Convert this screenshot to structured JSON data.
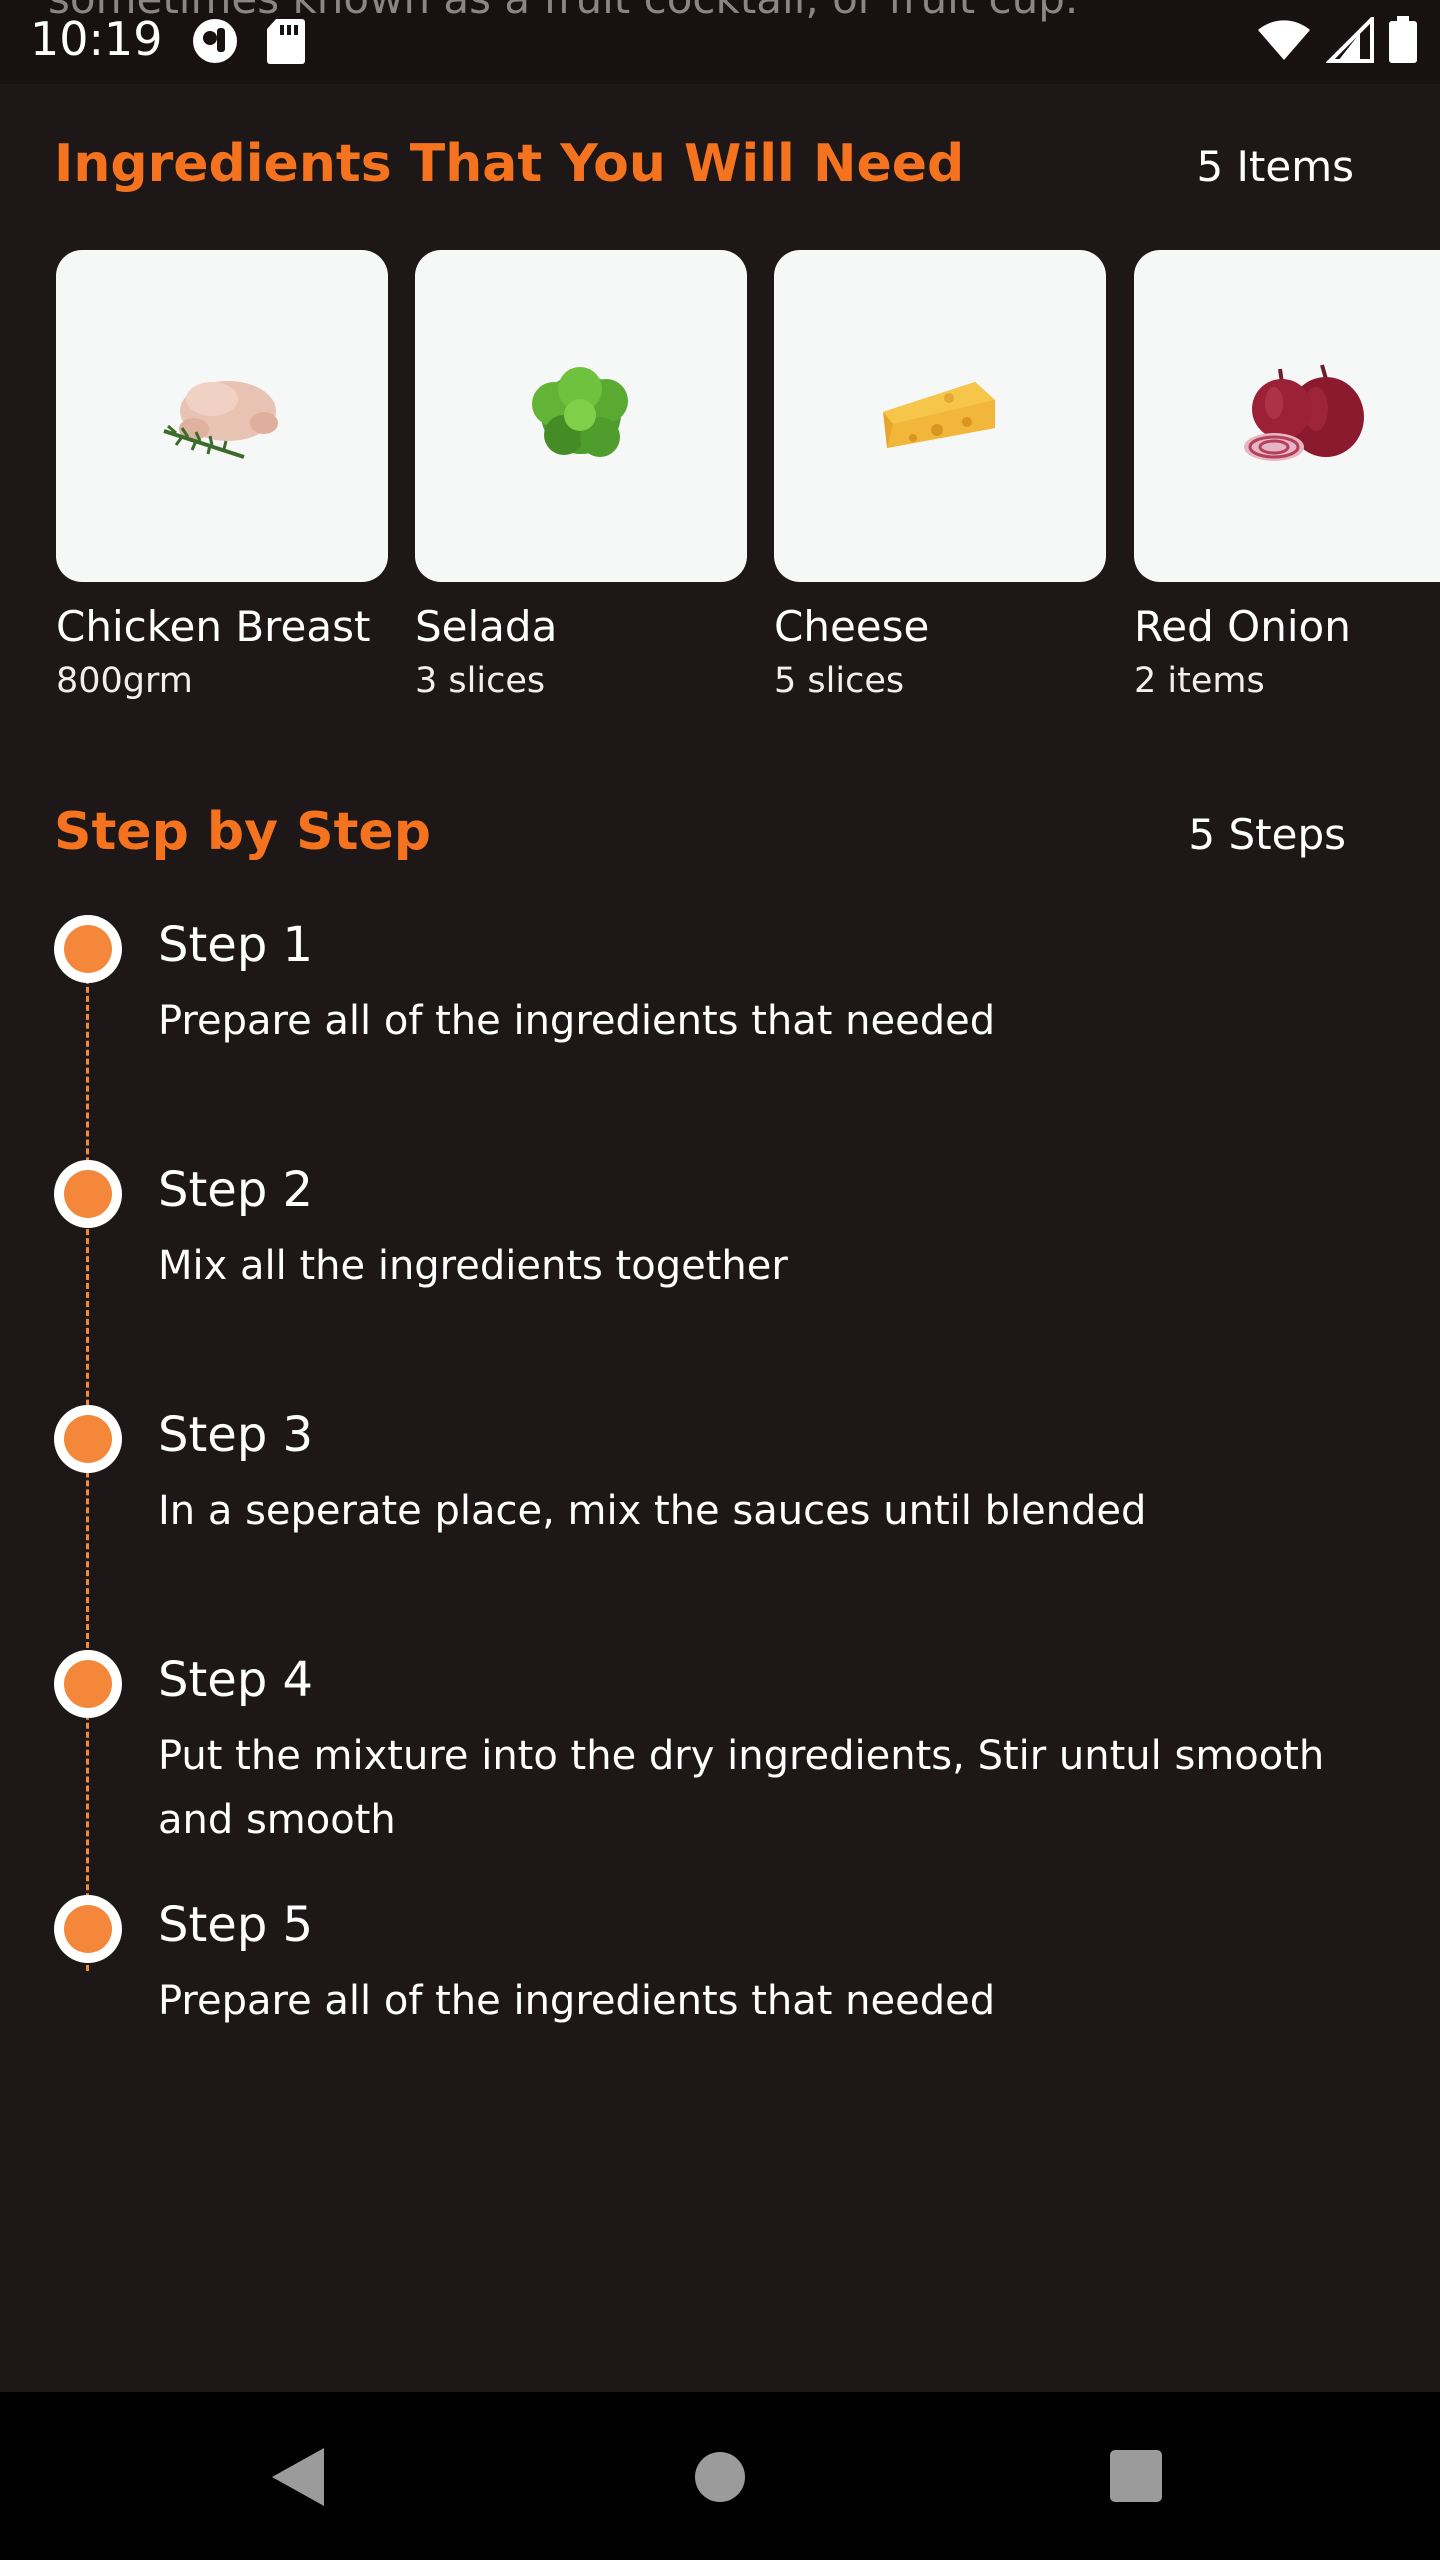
{
  "status_bar": {
    "background_text": "sometimes known as a fruit cocktail, or fruit cup.",
    "time": "10:19"
  },
  "ingredients": {
    "title": "Ingredients That You Will Need",
    "count": "5 Items",
    "items": [
      {
        "name": "Chicken Breast",
        "quantity": "800grm",
        "icon": "chicken-image"
      },
      {
        "name": "Selada",
        "quantity": "3 slices",
        "icon": "lettuce-image"
      },
      {
        "name": "Cheese",
        "quantity": "5 slices",
        "icon": "cheese-image"
      },
      {
        "name": "Red Onion",
        "quantity": "2 items",
        "icon": "red-onion-image"
      }
    ]
  },
  "steps": {
    "title": "Step by Step",
    "count": "5 Steps",
    "items": [
      {
        "title": "Step 1",
        "description": "Prepare all of the ingredients that needed"
      },
      {
        "title": "Step 2",
        "description": "Mix all the ingredients together"
      },
      {
        "title": "Step 3",
        "description": "In a seperate place, mix the sauces until blended"
      },
      {
        "title": "Step 4",
        "description": "Put the mixture into the dry ingredients, Stir untul smooth and smooth"
      },
      {
        "title": "Step 5",
        "description": "Prepare all of the ingredients that needed"
      }
    ]
  },
  "colors": {
    "accent": "#f5731f",
    "background": "#1d1718",
    "tile": "#f6f7f7",
    "step_dot": "#f5873a"
  }
}
